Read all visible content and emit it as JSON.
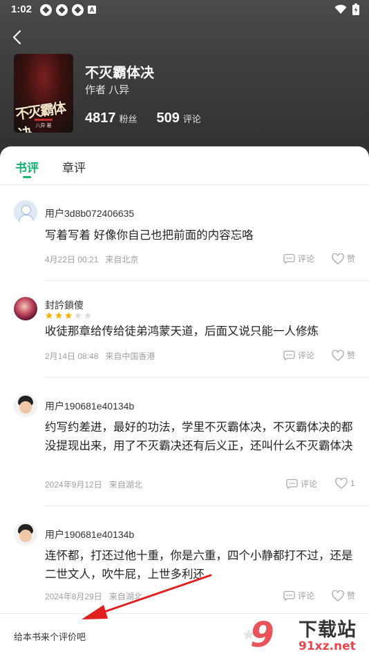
{
  "status": {
    "time": "1:02",
    "app_badge": "A"
  },
  "book": {
    "title": "不灭霸体决",
    "author": "作者 八异",
    "cover_title": "不灭霸体决",
    "cover_author": "八异 著",
    "fans_count": "4817",
    "fans_label": "粉丝",
    "comments_count": "509",
    "comments_label": "评论"
  },
  "tabs": {
    "book_review": "书评",
    "chapter_review": "章评"
  },
  "reviews": [
    {
      "user": "用户3d8b072406635",
      "content": "写着写着 好像你自己也把前面的内容忘咯",
      "date": "4月22日 00:21",
      "location": "来自北京",
      "comment_label": "评论",
      "like_label": "赞"
    },
    {
      "user": "封訡鎖傻",
      "rating": 3,
      "content": "收徒那章给传给徒弟鸿蒙天道，后面又说只能一人修炼",
      "date": "2月14日 08:48",
      "location": "来自中国香港",
      "comment_label": "评论",
      "like_label": "赞"
    },
    {
      "user": "用户190681e40134b",
      "content": "约写约差进，最好的功法，学里不灭霸体决，不灭霸体决的都没提现出来，用了不灭霸决还有后义正，还叫什么不灭霸体决",
      "date": "2024年9月12日",
      "location": "来自湖北",
      "comment_label": "评论",
      "like_label": "1"
    },
    {
      "user": "用户190681e40134b",
      "content": "连怀都，打还过他十重，你是六重，四个小静都打不过，还是二世文人，吹牛屁，上世多利还",
      "date": "2024年8月29日",
      "location": "来自湖北",
      "comment_label": "评论",
      "like_label": "赞"
    }
  ],
  "bottom": {
    "prompt": "给本书来个评价吧"
  },
  "watermark": {
    "nine": "9",
    "text": "下载站",
    "url": "91xz.net"
  },
  "colors": {
    "accent": "#14b56e",
    "star": "#f5b301",
    "watermark_red": "#e8454f",
    "arrow": "#e02020"
  }
}
